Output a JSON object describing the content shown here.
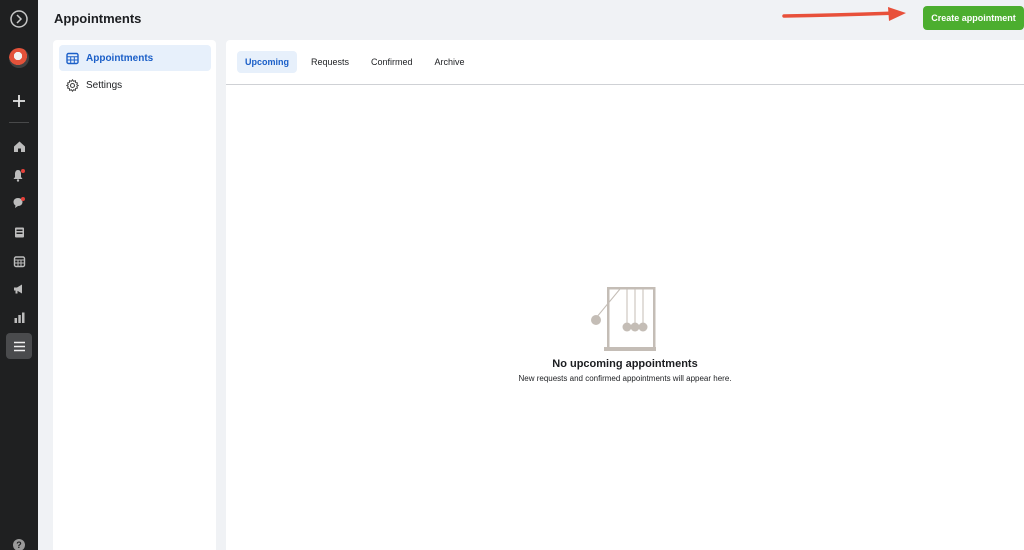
{
  "header": {
    "title": "Appointments",
    "create_label": "Create appointment"
  },
  "rail": {
    "icons": [
      "logo-icon",
      "avatar",
      "plus-icon",
      "home-icon",
      "bell-icon",
      "chat-icon",
      "pages-icon",
      "calendar-icon",
      "megaphone-icon",
      "bar-chart-icon",
      "menu-icon",
      "help-icon"
    ],
    "active": "menu-icon",
    "help_glyph": "?"
  },
  "sidebar": {
    "items": [
      {
        "label": "Appointments",
        "icon": "calendar-icon",
        "active": true
      },
      {
        "label": "Settings",
        "icon": "gear-icon",
        "active": false
      }
    ]
  },
  "tabs": [
    {
      "label": "Upcoming",
      "active": true
    },
    {
      "label": "Requests",
      "active": false
    },
    {
      "label": "Confirmed",
      "active": false
    },
    {
      "label": "Archive",
      "active": false
    }
  ],
  "empty_state": {
    "title": "No upcoming appointments",
    "subtitle": "New requests and confirmed appointments will appear here.",
    "icon": "newtons-cradle-icon"
  },
  "colors": {
    "accent": "#1b5fc8",
    "create_button": "#4cae2f",
    "rail": "#1f2021",
    "arrow": "#e8503a",
    "notification": "#e4413a"
  }
}
